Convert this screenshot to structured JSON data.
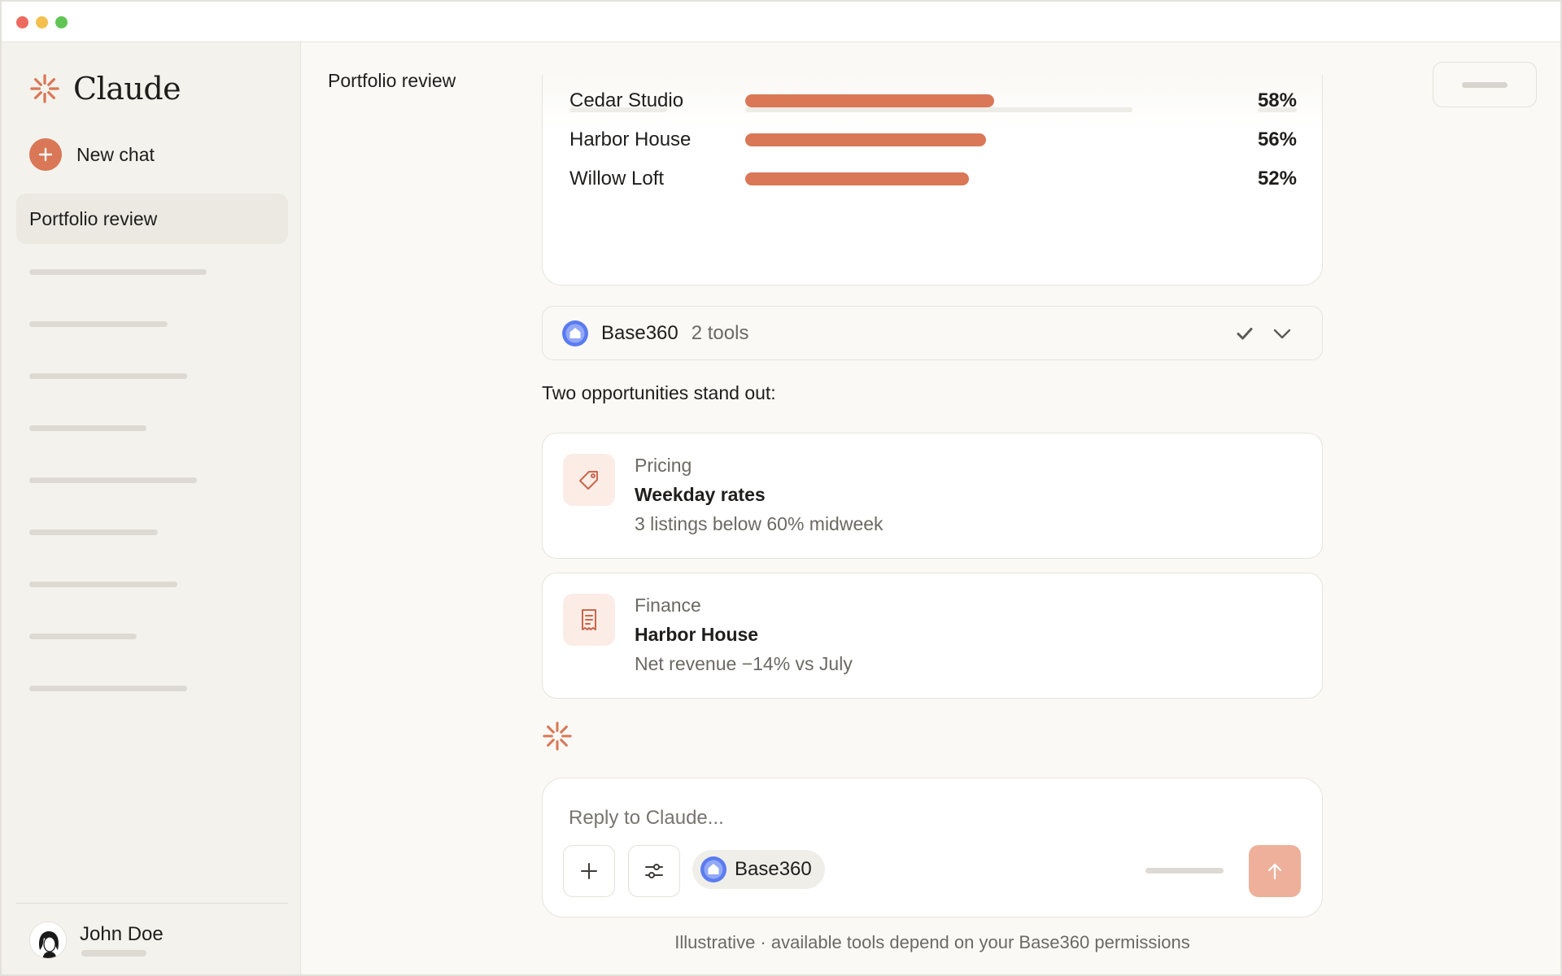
{
  "brand": {
    "name": "Claude",
    "icon": "claude-spark-icon",
    "accent": "#d97757"
  },
  "sidebar": {
    "new_chat_label": "New chat",
    "active_item": "Portfolio review",
    "user": {
      "name": "John Doe",
      "avatar": "user-avatar"
    }
  },
  "header": {
    "title": "Portfolio review"
  },
  "occupancy": {
    "rows": [
      {
        "label": "Cedar Studio",
        "value": "58%",
        "fraction": 0.58
      },
      {
        "label": "Harbor House",
        "value": "56%",
        "fraction": 0.56
      },
      {
        "label": "Willow Loft",
        "value": "52%",
        "fraction": 0.52
      }
    ]
  },
  "tool_call": {
    "name": "Base360",
    "count_label": "2 tools",
    "status_icon": "check-icon",
    "toggle_icon": "chevron-down-icon"
  },
  "message": {
    "lead": "Two opportunities stand out:",
    "opportunities": [
      {
        "category": "Pricing",
        "title": "Weekday rates",
        "detail": "3 listings below 60% midweek",
        "icon": "tag-icon"
      },
      {
        "category": "Finance",
        "title": "Harbor House",
        "detail": "Net revenue −14% vs July",
        "icon": "receipt-icon"
      }
    ]
  },
  "composer": {
    "placeholder": "Reply to Claude...",
    "connector_label": "Base360",
    "add_icon": "plus-icon",
    "settings_icon": "sliders-icon",
    "send_icon": "arrow-up-icon"
  },
  "footnote": "Illustrative · available tools depend on your Base360 permissions"
}
